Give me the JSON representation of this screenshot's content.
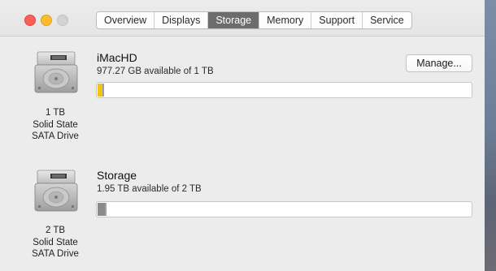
{
  "tabs": [
    "Overview",
    "Displays",
    "Storage",
    "Memory",
    "Support",
    "Service"
  ],
  "active_tab": "Storage",
  "manage_label": "Manage...",
  "drives": [
    {
      "name": "iMacHD",
      "available_text": "977.27 GB available of 1 TB",
      "caption_lines": [
        "1 TB",
        "Solid State",
        "SATA Drive"
      ],
      "used_fraction": 0.012,
      "fill_color": "#f2c21b",
      "icon": "hard-drive-icon"
    },
    {
      "name": "Storage",
      "available_text": "1.95 TB available of 2 TB",
      "caption_lines": [
        "2 TB",
        "Solid State",
        "SATA Drive"
      ],
      "used_fraction": 0.02,
      "fill_color": "#8a8a8a",
      "icon": "hard-drive-icon"
    }
  ],
  "colors": {
    "window_bg": "#ececec",
    "active_tab_bg": "#6c6c6c",
    "close": "#fc5f57",
    "minimize": "#fdbb2e",
    "zoom_inactive": "#d3d3d3"
  }
}
